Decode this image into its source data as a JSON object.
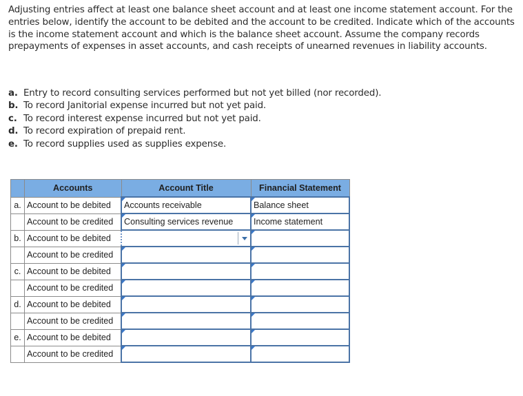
{
  "intro": "Adjusting entries affect at least one balance sheet account and at least one income statement account. For the entries below, identify the account to be debited and the account to be credited. Indicate which of the accounts is the income statement account and which is the balance sheet account. Assume the company records prepayments of expenses in asset accounts, and cash receipts of unearned revenues in liability accounts.",
  "entries": [
    {
      "label": "a.",
      "text": "Entry to record consulting services performed but not yet billed (nor recorded)."
    },
    {
      "label": "b.",
      "text": "To record Janitorial expense incurred but not yet paid."
    },
    {
      "label": "c.",
      "text": "To record interest expense incurred but not yet paid."
    },
    {
      "label": "d.",
      "text": "To record expiration of prepaid rent."
    },
    {
      "label": "e.",
      "text": "To record supplies used as supplies expense."
    }
  ],
  "table": {
    "headers": [
      "",
      "Accounts",
      "Account Title",
      "Financial Statement"
    ],
    "rows": [
      {
        "letter": "a.",
        "account": "Account to be debited",
        "title": "Accounts receivable",
        "statement": "Balance sheet"
      },
      {
        "letter": "",
        "account": "Account to be credited",
        "title": "Consulting services revenue",
        "statement": "Income statement"
      },
      {
        "letter": "b.",
        "account": "Account to be debited",
        "title": "",
        "statement": ""
      },
      {
        "letter": "",
        "account": "Account to be credited",
        "title": "",
        "statement": ""
      },
      {
        "letter": "c.",
        "account": "Account to be debited",
        "title": "",
        "statement": ""
      },
      {
        "letter": "",
        "account": "Account to be credited",
        "title": "",
        "statement": ""
      },
      {
        "letter": "d.",
        "account": "Account to be debited",
        "title": "",
        "statement": ""
      },
      {
        "letter": "",
        "account": "Account to be credited",
        "title": "",
        "statement": ""
      },
      {
        "letter": "e.",
        "account": "Account to be debited",
        "title": "",
        "statement": ""
      },
      {
        "letter": "",
        "account": "Account to be credited",
        "title": "",
        "statement": ""
      }
    ]
  },
  "colors": {
    "header_bg": "#7aade3",
    "input_border": "#4a73a6",
    "flag": "#3a78c9"
  }
}
